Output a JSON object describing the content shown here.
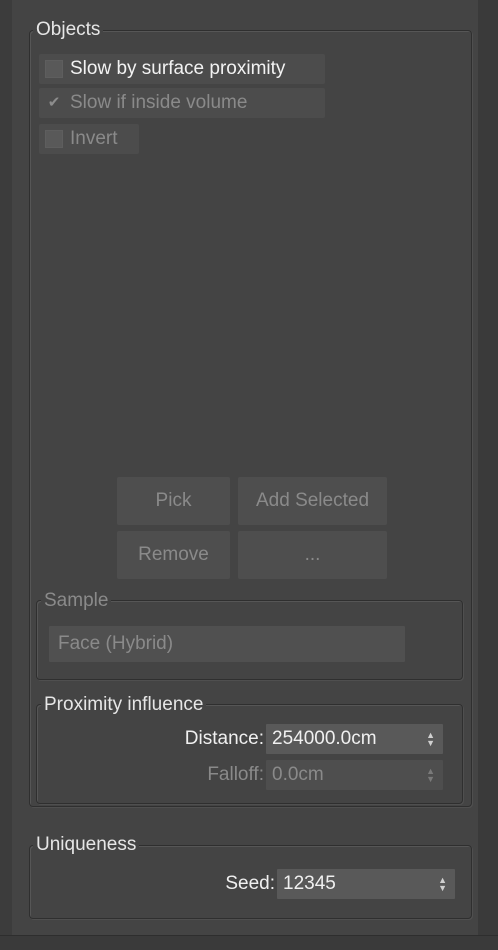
{
  "objects": {
    "title": "Objects",
    "slow_by_surface": {
      "label": "Slow by surface proximity",
      "checked": false
    },
    "slow_if_inside": {
      "label": "Slow if inside volume",
      "checked": true,
      "check_glyph": "✔"
    },
    "invert": {
      "label": "Invert",
      "checked": false
    },
    "buttons": {
      "pick": "Pick",
      "add_selected": "Add Selected",
      "remove": "Remove",
      "more": "..."
    },
    "sample": {
      "title": "Sample",
      "mode": "Face (Hybrid)"
    },
    "proximity": {
      "title": "Proximity influence",
      "distance_label": "Distance:",
      "distance_value": "254000.0cm",
      "falloff_label": "Falloff:",
      "falloff_value": "0.0cm"
    }
  },
  "uniqueness": {
    "title": "Uniqueness",
    "seed_label": "Seed:",
    "seed_value": "12345"
  },
  "colors": {
    "panel_bg": "#444444",
    "text": "#f0f0f0",
    "disabled_text": "#8a8a8a"
  }
}
